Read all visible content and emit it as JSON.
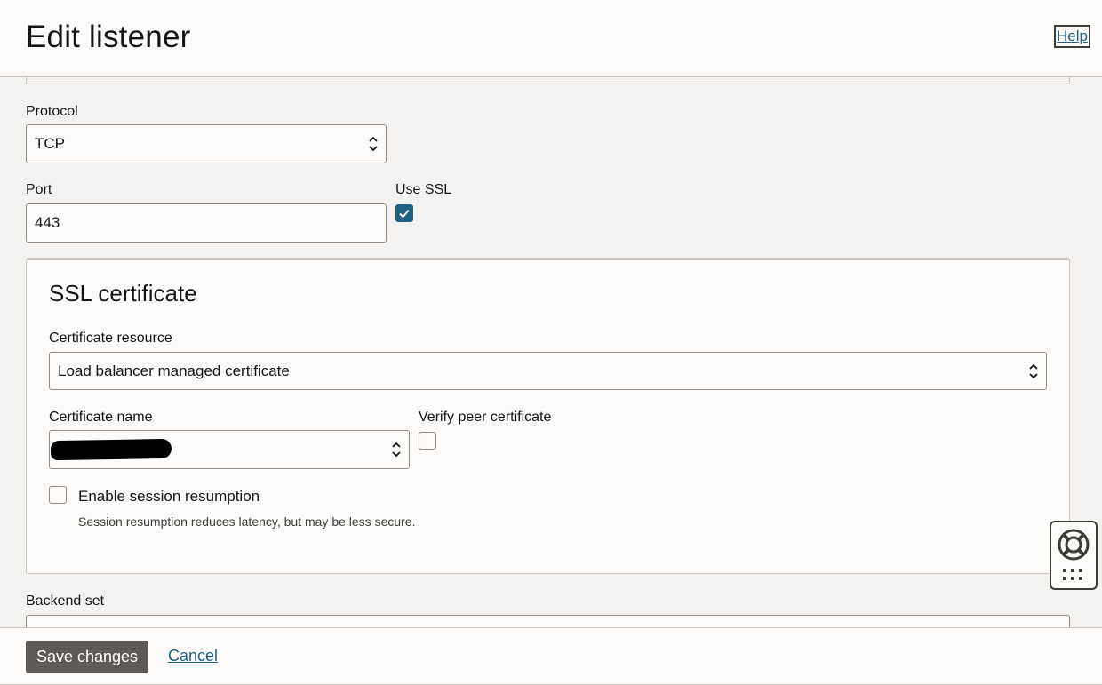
{
  "header": {
    "title": "Edit listener",
    "help_label": "Help"
  },
  "form": {
    "protocol": {
      "label": "Protocol",
      "value": "TCP"
    },
    "port": {
      "label": "Port",
      "value": "443"
    },
    "use_ssl": {
      "label": "Use SSL",
      "checked": true
    },
    "ssl_certificate": {
      "title": "SSL certificate",
      "certificate_resource": {
        "label": "Certificate resource",
        "value": "Load balancer managed certificate"
      },
      "certificate_name": {
        "label": "Certificate name",
        "value": ""
      },
      "verify_peer": {
        "label": "Verify peer certificate",
        "checked": false
      },
      "session_resumption": {
        "label": "Enable session resumption",
        "checked": false,
        "hint": "Session resumption reduces latency, but may be less secure."
      }
    },
    "backend_set": {
      "label": "Backend set"
    }
  },
  "footer": {
    "save_label": "Save changes",
    "cancel_label": "Cancel"
  },
  "colors": {
    "accent": "#1d6082",
    "button": "#5f5a55",
    "background": "#f3f2f1",
    "surface": "#fcfbfa"
  },
  "icons": {
    "select": "chevron-updown-icon",
    "help_widget": "lifebuoy-icon",
    "apps": "grid-dots-icon"
  }
}
